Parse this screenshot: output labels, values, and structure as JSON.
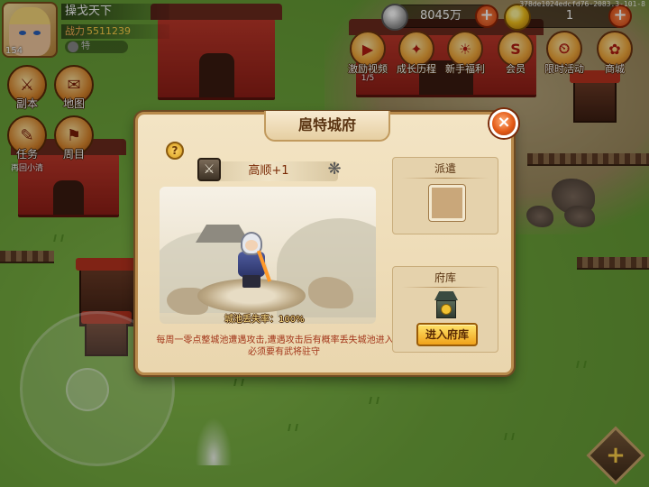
{
  "build_id": "378de1024edcfd76-2083.3-101-8",
  "player": {
    "name": "操戈天下",
    "power_label": "战力",
    "power": "5511239",
    "level": "154",
    "vip": "特"
  },
  "currency": {
    "coins": "8045万",
    "gold": "1"
  },
  "activities": [
    {
      "label": "激励视频",
      "sub": "1/5",
      "glyph": "▶"
    },
    {
      "label": "成长历程",
      "sub": "",
      "glyph": "✦"
    },
    {
      "label": "新手福利",
      "sub": "",
      "glyph": "☀"
    },
    {
      "label": "会员",
      "sub": "",
      "glyph": "S"
    },
    {
      "label": "限时活动",
      "sub": "",
      "glyph": "⏲"
    },
    {
      "label": "商城",
      "sub": "",
      "glyph": "✿"
    }
  ],
  "side_menu": [
    {
      "label": "副本",
      "sub": "",
      "glyph": "⚔"
    },
    {
      "label": "地图",
      "sub": "",
      "glyph": "✉"
    },
    {
      "label": "任务",
      "sub": "再回小清",
      "glyph": "✎"
    },
    {
      "label": "周目",
      "sub": "",
      "glyph": "⚑"
    }
  ],
  "modal": {
    "title": "扈特城府",
    "help": "?",
    "close": "×",
    "general": "高顺+1",
    "loss_rate": "城池丢失率：100%",
    "description": "每周一零点整城池遭遇攻击,遭遇攻击后有概率丢失城池进入府库必须要有武将驻守",
    "dispatch_title": "派遣",
    "treasury_title": "府库",
    "enter_button": "进入府库"
  },
  "colors": {
    "accent": "#e35a16",
    "panel": "#f3e4c4",
    "desc_text": "#a3361a"
  }
}
